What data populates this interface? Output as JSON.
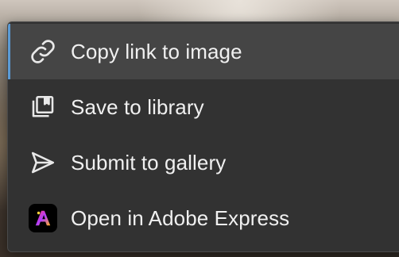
{
  "menu": {
    "items": [
      {
        "label": "Copy link to image",
        "icon": "link-icon",
        "active": true
      },
      {
        "label": "Save to library",
        "icon": "library-icon",
        "active": false
      },
      {
        "label": "Submit to gallery",
        "icon": "send-icon",
        "active": false
      },
      {
        "label": "Open in Adobe Express",
        "icon": "adobe-express-icon",
        "active": false
      }
    ]
  },
  "colors": {
    "menu_bg": "#323232",
    "hover_bg": "#454545",
    "accent": "#5b9bd5",
    "text": "#f0f0f0"
  }
}
